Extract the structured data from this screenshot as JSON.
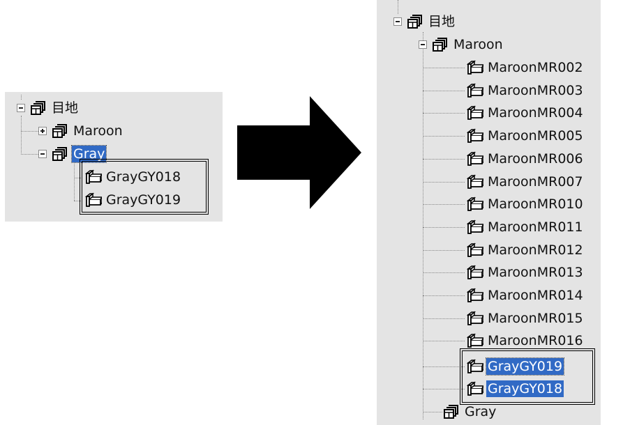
{
  "before": {
    "root": {
      "label": "目地",
      "expander": "minus",
      "icon": "group-icon"
    },
    "groups": [
      {
        "label": "Maroon",
        "expander": "plus",
        "icon": "group-icon",
        "selected": false
      },
      {
        "label": "Gray",
        "expander": "minus",
        "icon": "group-icon",
        "selected": true
      }
    ],
    "items": [
      {
        "label": "GrayGY018",
        "icon": "part-icon"
      },
      {
        "label": "GrayGY019",
        "icon": "part-icon"
      }
    ]
  },
  "arrow": {
    "icon": "right-arrow-icon",
    "color": "#000000"
  },
  "after": {
    "root": {
      "label": "目地",
      "expander": "minus",
      "icon": "group-icon"
    },
    "maroon": {
      "label": "Maroon",
      "expander": "minus",
      "icon": "group-icon"
    },
    "maroon_items": [
      "MaroonMR002",
      "MaroonMR003",
      "MaroonMR004",
      "MaroonMR005",
      "MaroonMR006",
      "MaroonMR007",
      "MaroonMR010",
      "MaroonMR011",
      "MaroonMR012",
      "MaroonMR013",
      "MaroonMR014",
      "MaroonMR015",
      "MaroonMR016"
    ],
    "moved_items": [
      {
        "label": "GrayGY019",
        "selected": true
      },
      {
        "label": "GrayGY018",
        "selected": true
      }
    ],
    "gray": {
      "label": "Gray",
      "icon": "group-icon"
    }
  },
  "colors": {
    "panel": "#e4e4e4",
    "selection": "#316ac5",
    "selected_text": "#ffffff"
  }
}
